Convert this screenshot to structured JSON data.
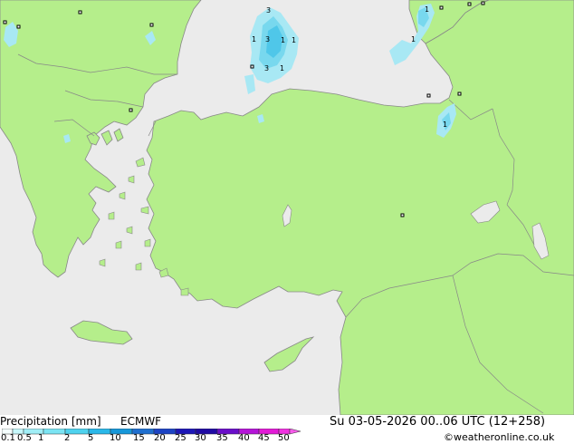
{
  "footer": {
    "title": "Precipitation [mm]",
    "model": "ECMWF",
    "datetime": "Su 03-05-2026 00..06 UTC (12+258)",
    "credit": "©weatheronline.co.uk",
    "legend_labels": [
      "0.1",
      "0.5",
      "1",
      "2",
      "5",
      "10",
      "15",
      "20",
      "25",
      "30",
      "35",
      "40",
      "45",
      "50"
    ],
    "legend_colors": [
      "#f5fffe",
      "#c6f7fa",
      "#a0eef6",
      "#7be4f3",
      "#4fd2ee",
      "#2ab8e9",
      "#1697d9",
      "#1f6fcf",
      "#1d44c4",
      "#1d17b7",
      "#1f0aa3",
      "#6a0ec9",
      "#b414d7",
      "#e21ad6",
      "#f032e0",
      "#f65ae9"
    ]
  },
  "colors": {
    "land": "#b5ee8b",
    "sea": "#ebebeb",
    "border": "#888888",
    "precip_light": "#a8e8f4",
    "precip_mid": "#78d8ee",
    "precip_strong": "#4fc7e9"
  },
  "precip_values": [
    "3",
    "1",
    "3",
    "1",
    "1",
    "3",
    "1",
    "1",
    "1",
    "1"
  ]
}
